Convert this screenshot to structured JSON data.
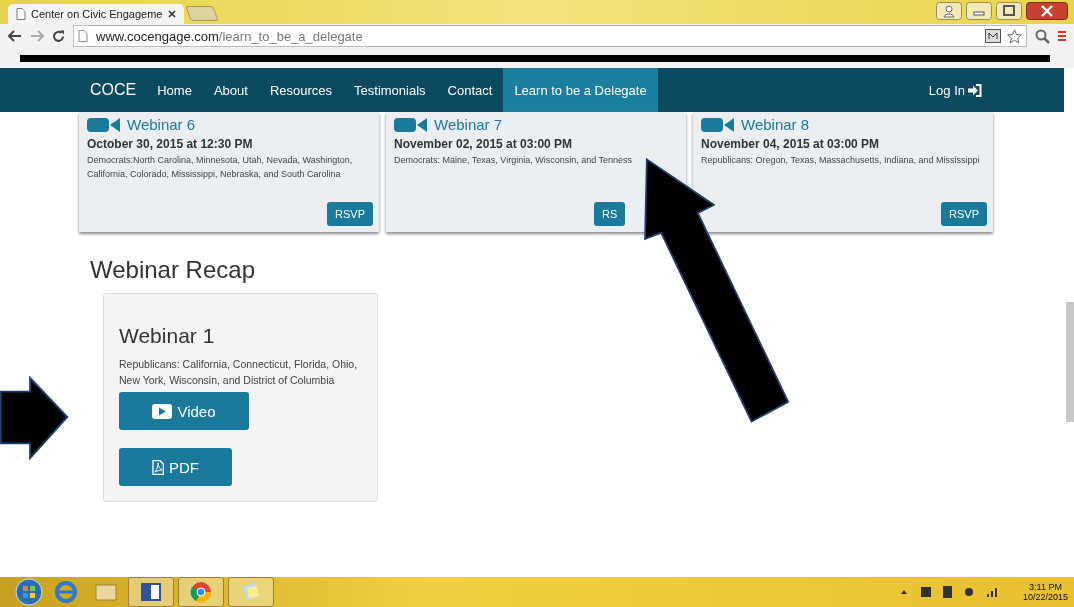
{
  "browser": {
    "tabs": [
      {
        "title": "Center on Civic Engageme",
        "selected": true
      }
    ],
    "url_domain": "www.cocengage.com",
    "url_path": "/learn_to_be_a_delegate"
  },
  "navbar": {
    "brand": "COCE",
    "items": [
      {
        "label": "Home",
        "selected": false
      },
      {
        "label": "About",
        "selected": false
      },
      {
        "label": "Resources",
        "selected": false
      },
      {
        "label": "Testimonials",
        "selected": false
      },
      {
        "label": "Contact",
        "selected": false
      },
      {
        "label": "Learn to be a Delegate",
        "selected": true
      }
    ],
    "login": "Log In"
  },
  "upcoming_webinars": [
    {
      "title": "Webinar 6",
      "date": "October 30, 2015 at 12:30 PM",
      "description": "Democrats:North Carolina, Minnesota, Utah, Nevada, Washington, California, Colorado, Mississippi, Nebraska, and South Carolina",
      "button": "RSVP"
    },
    {
      "title": "Webinar 7",
      "date": "November 02, 2015 at 03:00 PM",
      "description": "Democrats: Maine, Texas, Virginia, Wisconsin, and Tenness",
      "button": "RS"
    },
    {
      "title": "Webinar 8",
      "date": "November 04, 2015 at 03:00 PM",
      "description": "Republicans: Oregon, Texas, Massachusetts, Indiana, and Mississippi",
      "button": "RSVP"
    }
  ],
  "recap": {
    "heading": "Webinar Recap",
    "cards": [
      {
        "title": "Webinar 1",
        "description": "Republicans: California, Connecticut, Florida, Ohio, New York, Wisconsin, and District of Columbia",
        "buttons": [
          {
            "kind": "video",
            "label": "Video"
          },
          {
            "kind": "pdf",
            "label": "PDF"
          }
        ]
      }
    ]
  },
  "taskbar": {
    "time": "3:11 PM",
    "date": "10/22/2015"
  }
}
